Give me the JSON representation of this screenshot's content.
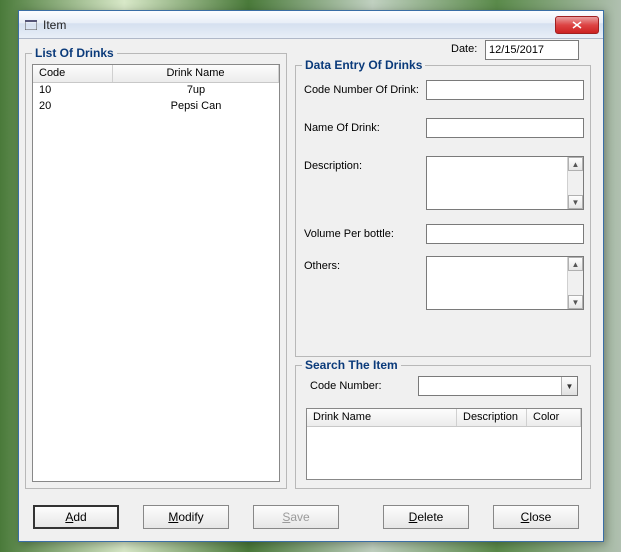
{
  "window": {
    "title": "Item"
  },
  "date": {
    "label": "Date:",
    "value": "12/15/2017"
  },
  "list": {
    "legend": "List Of Drinks",
    "columns": {
      "code": "Code",
      "name": "Drink Name"
    },
    "rows": [
      {
        "code": "10",
        "name": "7up"
      },
      {
        "code": "20",
        "name": "Pepsi Can"
      }
    ]
  },
  "entry": {
    "legend": "Data Entry Of Drinks",
    "code_label": "Code Number Of Drink:",
    "name_label": "Name Of Drink:",
    "desc_label": "Description:",
    "volume_label": "Volume Per bottle:",
    "others_label": "Others:",
    "code_value": "",
    "name_value": "",
    "desc_value": "",
    "volume_value": "",
    "others_value": ""
  },
  "search": {
    "legend": "Search The Item",
    "code_label": "Code Number:",
    "code_value": "",
    "columns": {
      "name": "Drink Name",
      "desc": "Description",
      "color": "Color"
    }
  },
  "buttons": {
    "add": "Add",
    "modify": "Modify",
    "save": "Save",
    "delete": "Delete",
    "close": "Close"
  }
}
